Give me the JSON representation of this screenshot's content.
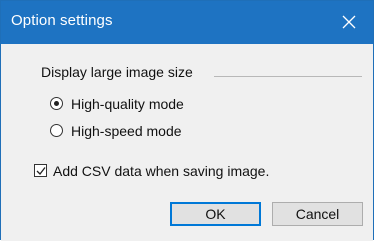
{
  "window": {
    "title": "Option settings"
  },
  "group": {
    "label": "Display large image size"
  },
  "options": [
    {
      "label": "High-quality mode",
      "selected": true
    },
    {
      "label": "High-speed mode",
      "selected": false
    }
  ],
  "checkbox": {
    "label": "Add CSV data when saving image.",
    "checked": true
  },
  "buttons": {
    "ok_label": "OK",
    "cancel_label": "Cancel"
  },
  "colors": {
    "titlebar": "#1e73c2",
    "dialog_bg": "#f0f0f0",
    "default_button_border": "#0078d7"
  },
  "icons": {
    "close": "close-icon",
    "check": "checkmark-icon"
  }
}
